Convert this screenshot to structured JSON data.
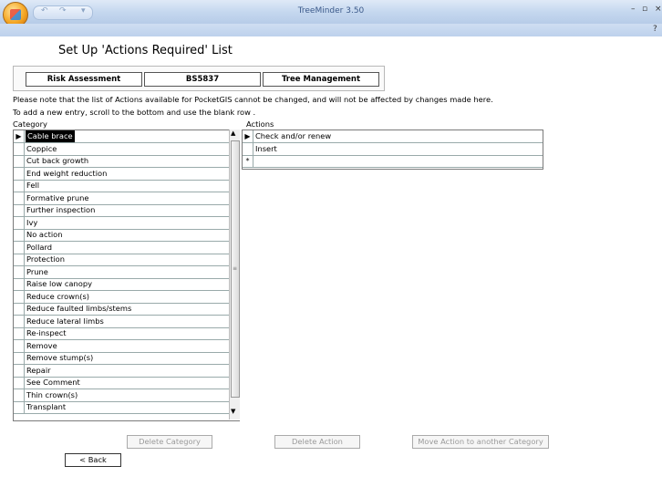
{
  "window": {
    "app_title": "TreeMinder 3.50"
  },
  "page": {
    "title": "Set Up 'Actions Required' List"
  },
  "tabs": [
    {
      "label": "Risk Assessment"
    },
    {
      "label": "BS5837"
    },
    {
      "label": "Tree Management"
    }
  ],
  "notes": {
    "line1": "Please note that the list of Actions available for PocketGIS cannot be changed, and will not be affected by changes made here.",
    "line2": "To add a new entry, scroll to the bottom and use the blank row ."
  },
  "category_list": {
    "header": "Category",
    "items": [
      "Cable brace",
      "Coppice",
      "Cut back growth",
      "End weight reduction",
      "Fell",
      "Formative prune",
      "Further inspection",
      "Ivy",
      "No action",
      "Pollard",
      "Protection",
      "Prune",
      "Raise low canopy",
      "Reduce crown(s)",
      "Reduce faulted limbs/stems",
      "Reduce lateral limbs",
      "Re-inspect",
      "Remove",
      "Remove stump(s)",
      "Repair",
      "See Comment",
      "Thin crown(s)",
      "Transplant"
    ],
    "current_index": 0
  },
  "actions_list": {
    "header": "Actions",
    "items": [
      "Check and/or renew",
      "Insert"
    ],
    "new_row_marker": "*"
  },
  "buttons": {
    "delete_category": "Delete Category",
    "delete_action": "Delete Action",
    "move_action": "Move Action to another Category",
    "back": "< Back"
  }
}
